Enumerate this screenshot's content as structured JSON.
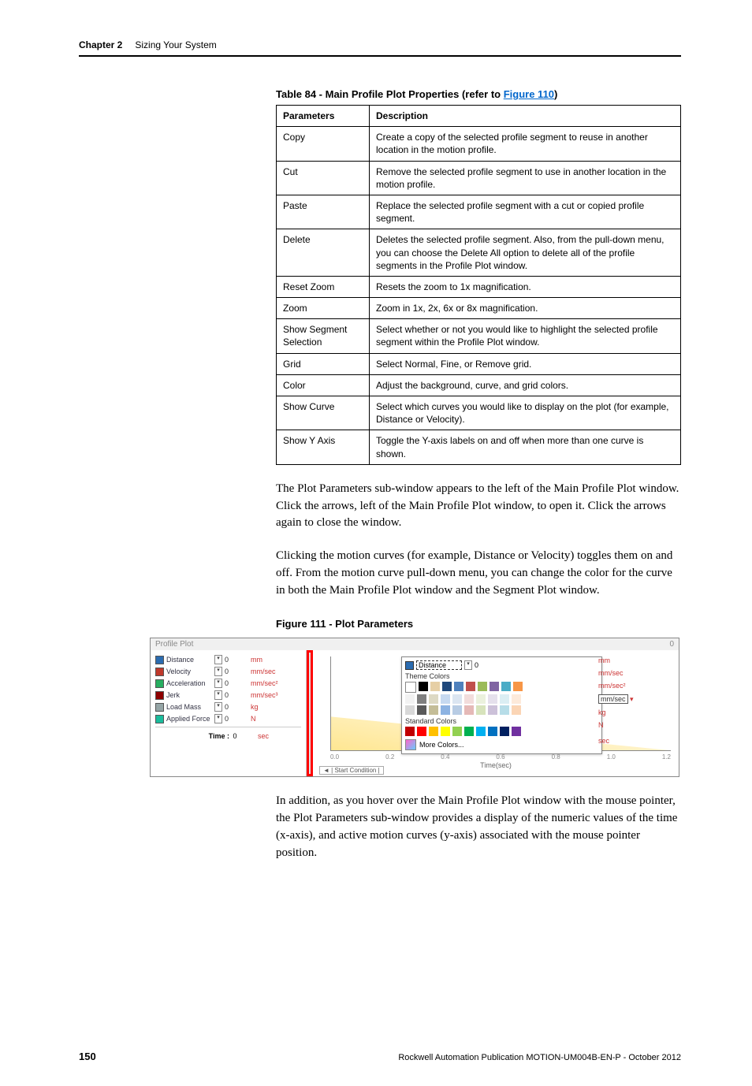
{
  "header": {
    "chapter": "Chapter 2",
    "title": "Sizing Your System"
  },
  "table": {
    "title_prefix": "Table 84 - Main Profile Plot Properties (refer to ",
    "title_link": "Figure 110",
    "title_suffix": ")",
    "col_param": "Parameters",
    "col_desc": "Description",
    "rows": [
      {
        "param": "Copy",
        "desc": "Create a copy of the selected profile segment to reuse in another location in the motion profile."
      },
      {
        "param": "Cut",
        "desc": "Remove the selected profile segment to use in another location in the motion profile."
      },
      {
        "param": "Paste",
        "desc": "Replace the selected profile segment with a cut or copied profile segment."
      },
      {
        "param": "Delete",
        "desc": "Deletes the selected profile segment. Also, from the pull-down menu, you can choose the Delete All option to delete all of the profile segments in the Profile Plot window."
      },
      {
        "param": "Reset Zoom",
        "desc": "Resets the zoom to 1x magnification."
      },
      {
        "param": "Zoom",
        "desc": "Zoom in 1x, 2x, 6x or 8x magnification."
      },
      {
        "param": "Show Segment Selection",
        "desc": "Select whether or not you would like to highlight the selected profile segment within the Profile Plot window."
      },
      {
        "param": "Grid",
        "desc": "Select Normal, Fine, or Remove grid."
      },
      {
        "param": "Color",
        "desc": "Adjust the background, curve, and grid colors."
      },
      {
        "param": "Show Curve",
        "desc": "Select which curves you would like to display on the plot (for example, Distance or Velocity)."
      },
      {
        "param": "Show Y Axis",
        "desc": "Toggle the Y-axis labels on and off when more than one curve is shown."
      }
    ]
  },
  "paragraphs": {
    "p1": "The Plot Parameters sub-window appears to the left of the Main Profile Plot window. Click the arrows, left of the Main Profile Plot window, to open it. Click the arrows again to close the window.",
    "p2": "Clicking the motion curves (for example, Distance or Velocity) toggles them on and off. From the motion curve pull-down menu, you can change the color for the curve in both the Main Profile Plot window and the Segment Plot window.",
    "p3": "In addition, as you hover over the Main Profile Plot window with the mouse pointer, the Plot Parameters sub-window provides a display of the numeric values of the time (x-axis), and active motion curves (y-axis) associated with the mouse pointer position."
  },
  "figure": {
    "title": "Figure 111 - Plot Parameters"
  },
  "screenshot": {
    "window_title": "Profile Plot",
    "legend": [
      {
        "label": "Distance",
        "color": "#2b6cb0",
        "value": "0",
        "unit": "mm"
      },
      {
        "label": "Velocity",
        "color": "#c0392b",
        "value": "0",
        "unit": "mm/sec"
      },
      {
        "label": "Acceleration",
        "color": "#27ae60",
        "value": "0",
        "unit": "mm/sec²"
      },
      {
        "label": "Jerk",
        "color": "#8e0000",
        "value": "0",
        "unit": "mm/sec³"
      },
      {
        "label": "Load Mass",
        "color": "#95a5a6",
        "value": "0",
        "unit": "kg"
      },
      {
        "label": "Applied Force",
        "color": "#1abc9c",
        "value": "0",
        "unit": "N"
      }
    ],
    "time_label": "Time :",
    "time_value": "0",
    "time_unit": "sec",
    "overlay": {
      "selected": "Distance",
      "selected_value": "0",
      "theme_label": "Theme Colors",
      "standard_label": "Standard Colors",
      "more_colors": "More Colors...",
      "units": [
        "mm",
        "mm/sec",
        "mm/sec²",
        "mm/sec",
        "kg",
        "N",
        "sec"
      ]
    },
    "plot": {
      "x_label": "Time(sec)",
      "start_condition": "◄ | Start Condition |",
      "ticks": [
        "0.0",
        "0.2",
        "0.4",
        "0.6",
        "0.8",
        "1.0",
        "1.2"
      ]
    }
  },
  "footer": {
    "page": "150",
    "pub": "Rockwell Automation Publication MOTION-UM004B-EN-P - October 2012"
  }
}
